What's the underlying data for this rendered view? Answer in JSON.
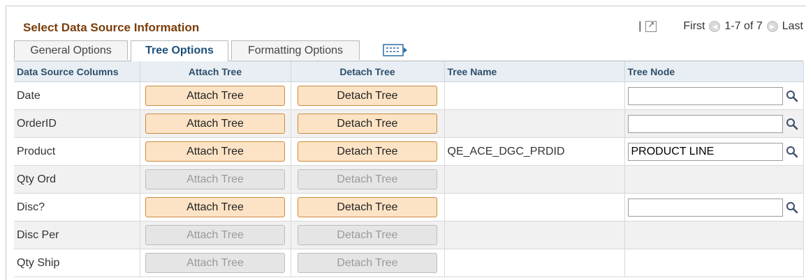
{
  "header": {
    "title": "Select Data Source Information",
    "separator": "|",
    "nav_first": "First",
    "nav_range": "1-7 of 7",
    "nav_last": "Last"
  },
  "tabs": [
    {
      "label": "General Options",
      "active": false
    },
    {
      "label": "Tree Options",
      "active": true
    },
    {
      "label": "Formatting Options",
      "active": false
    }
  ],
  "grid": {
    "columns": [
      "Data Source Columns",
      "Attach Tree",
      "Detach Tree",
      "Tree Name",
      "Tree Node"
    ],
    "rows": [
      {
        "column": "Date",
        "attach": "Attach Tree",
        "detach": "Detach Tree",
        "enabled": true,
        "tree_name": "",
        "tree_node": "",
        "has_node": true
      },
      {
        "column": "OrderID",
        "attach": "Attach Tree",
        "detach": "Detach Tree",
        "enabled": true,
        "tree_name": "",
        "tree_node": "",
        "has_node": true
      },
      {
        "column": "Product",
        "attach": "Attach Tree",
        "detach": "Detach Tree",
        "enabled": true,
        "tree_name": "QE_ACE_DGC_PRDID",
        "tree_node": "PRODUCT LINE",
        "has_node": true
      },
      {
        "column": "Qty Ord",
        "attach": "Attach Tree",
        "detach": "Detach Tree",
        "enabled": false,
        "tree_name": "",
        "tree_node": "",
        "has_node": false
      },
      {
        "column": "Disc?",
        "attach": "Attach Tree",
        "detach": "Detach Tree",
        "enabled": true,
        "tree_name": "",
        "tree_node": "",
        "has_node": true
      },
      {
        "column": "Disc Per",
        "attach": "Attach Tree",
        "detach": "Detach Tree",
        "enabled": false,
        "tree_name": "",
        "tree_node": "",
        "has_node": false
      },
      {
        "column": "Qty Ship",
        "attach": "Attach Tree",
        "detach": "Detach Tree",
        "enabled": false,
        "tree_name": "",
        "tree_node": "",
        "has_node": false
      }
    ]
  },
  "colors": {
    "title": "#7a3d0a",
    "header_bg": "#e8eef3",
    "button_enabled": "#fde3c5",
    "button_disabled": "#e5e5e5"
  },
  "icons": {
    "view_all": "view-all-icon",
    "prev": "previous-icon",
    "next": "next-icon",
    "grid_view": "grid-view-icon",
    "lookup": "lookup-icon"
  }
}
